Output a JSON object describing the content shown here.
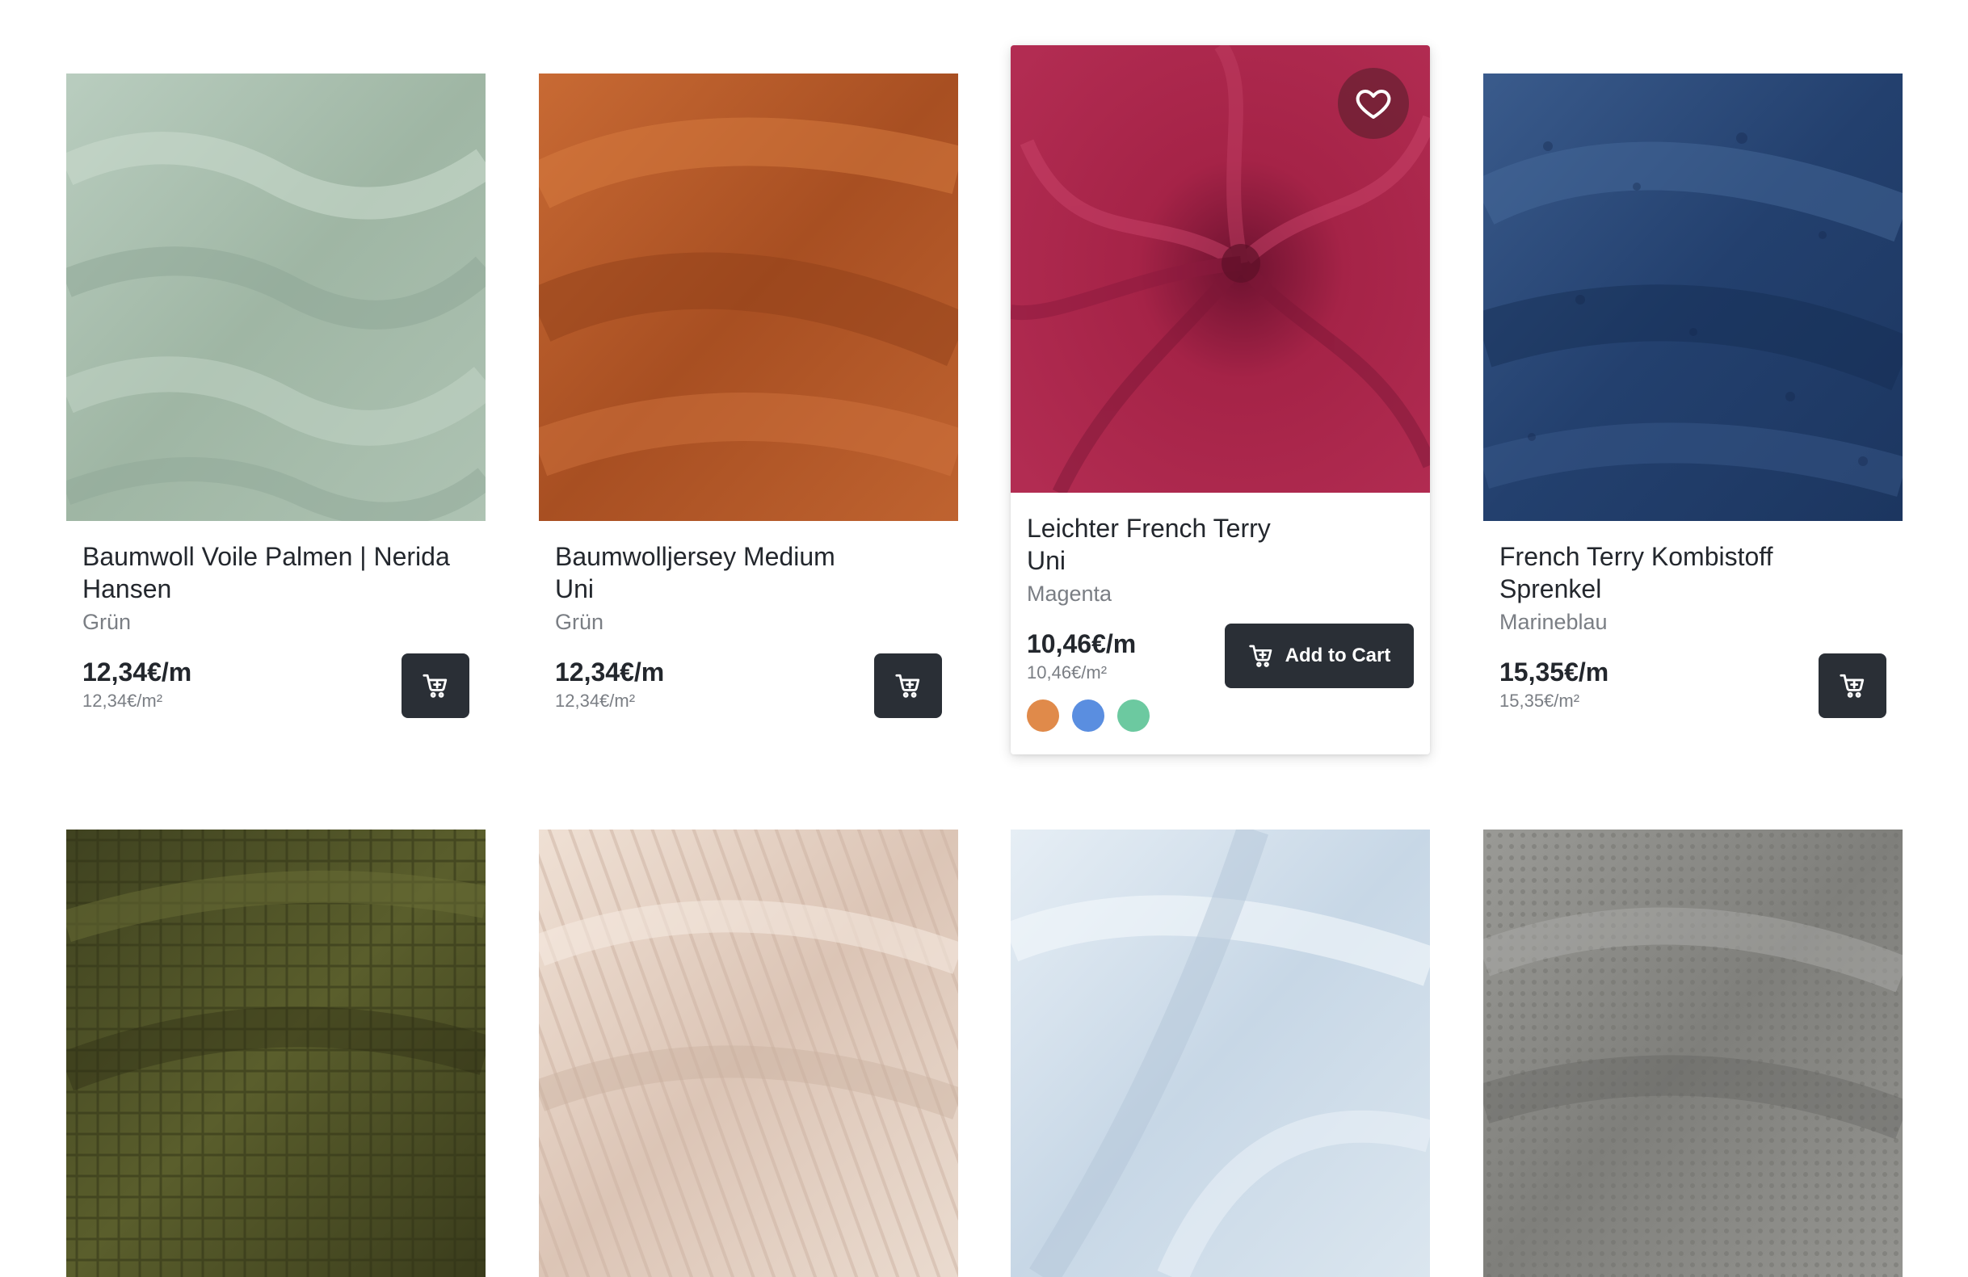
{
  "products": [
    {
      "title": "Baumwoll Voile Palmen | Nerida\nHansen",
      "color_name": "Grün",
      "price": "12,34€/m",
      "price_sqm": "12,34€/m²",
      "image": "fabric-mint-green-muslin",
      "base_color": "#a9bfaf"
    },
    {
      "title": "Baumwolljersey Medium\nUni",
      "color_name": "Grün",
      "price": "12,34€/m",
      "price_sqm": "12,34€/m²",
      "image": "fabric-rust-orange-jersey",
      "base_color": "#b95d2c"
    },
    {
      "title": "Leichter French Terry\nUni",
      "color_name": "Magenta",
      "price": "10,46€/m",
      "price_sqm": "10,46€/m²",
      "image": "fabric-magenta-swirl",
      "base_color": "#a8254a",
      "add_to_cart_label": "Add to Cart",
      "swatches": [
        "#e08a4a",
        "#5a8ee0",
        "#6cc9a0"
      ]
    },
    {
      "title": "French Terry Kombistoff\nSprenkel",
      "color_name": "Marineblau",
      "price": "15,35€/m",
      "price_sqm": "15,35€/m²",
      "image": "fabric-navy-speckled",
      "base_color": "#2d4a78"
    },
    {
      "image": "fabric-olive-waffle",
      "base_color": "#4f5226"
    },
    {
      "image": "fabric-blush-rib-knit",
      "base_color": "#e6d3c6"
    },
    {
      "image": "fabric-light-blue-knit",
      "base_color": "#d6e3ee"
    },
    {
      "image": "fabric-grey-waffle-knit",
      "base_color": "#8f8f8b"
    }
  ]
}
